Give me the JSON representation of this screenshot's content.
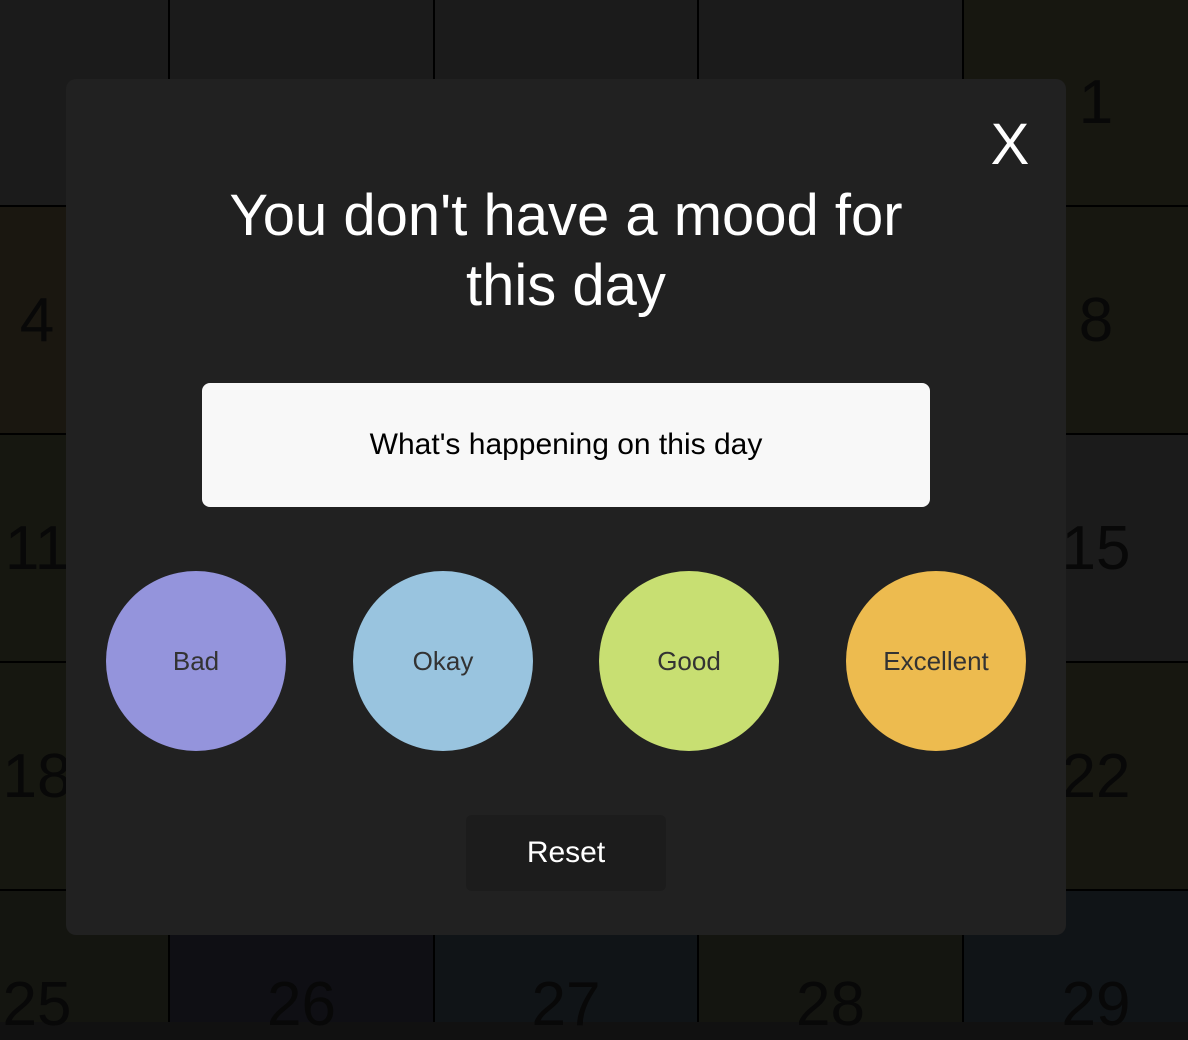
{
  "calendar": {
    "cells": [
      {
        "day": "",
        "color": "#1b1b1b"
      },
      {
        "day": "",
        "color": "#1b1b1b"
      },
      {
        "day": "",
        "color": "#1b1b1b"
      },
      {
        "day": "",
        "color": "#1b1b1b"
      },
      {
        "day": "1",
        "color": "#171710"
      },
      {
        "day": "4",
        "color": "#1a1710"
      },
      {
        "day": "",
        "color": "#1b1b1b"
      },
      {
        "day": "",
        "color": "#1b1b1b"
      },
      {
        "day": "",
        "color": "#1b1b1b"
      },
      {
        "day": "8",
        "color": "#171710"
      },
      {
        "day": "11",
        "color": "#161710"
      },
      {
        "day": "",
        "color": "#1b1b1b"
      },
      {
        "day": "",
        "color": "#1b1b1b"
      },
      {
        "day": "",
        "color": "#1b1b1b"
      },
      {
        "day": "15",
        "color": "#1b1b1b"
      },
      {
        "day": "18",
        "color": "#161710"
      },
      {
        "day": "",
        "color": "#1b1b1b"
      },
      {
        "day": "",
        "color": "#1b1b1b"
      },
      {
        "day": "",
        "color": "#1b1b1b"
      },
      {
        "day": "22",
        "color": "#171710"
      },
      {
        "day": "25",
        "color": "#141510"
      },
      {
        "day": "26",
        "color": "#0f0f14"
      },
      {
        "day": "27",
        "color": "#101417"
      },
      {
        "day": "28",
        "color": "#141510"
      },
      {
        "day": "29",
        "color": "#101417"
      }
    ]
  },
  "modal": {
    "close_label": "X",
    "title": "You don't have a mood for this day",
    "note_placeholder": "What's happening on this day",
    "moods": [
      {
        "label": "Bad",
        "color": "#9494dc"
      },
      {
        "label": "Okay",
        "color": "#99c4df"
      },
      {
        "label": "Good",
        "color": "#c8df72"
      },
      {
        "label": "Excellent",
        "color": "#edbb4f"
      }
    ],
    "reset_label": "Reset"
  }
}
